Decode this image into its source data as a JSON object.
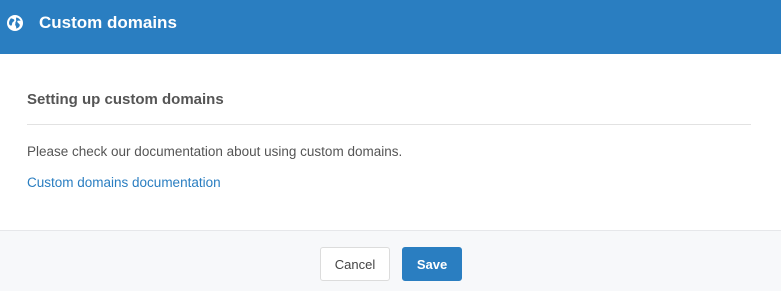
{
  "header": {
    "icon": "globe-icon",
    "title": "Custom domains"
  },
  "body": {
    "section_title": "Setting up custom domains",
    "description": "Please check our documentation about using custom domains.",
    "link_label": "Custom domains documentation"
  },
  "footer": {
    "cancel_label": "Cancel",
    "save_label": "Save"
  },
  "colors": {
    "accent": "#2a7ec1",
    "text": "#555555",
    "footer_bg": "#f7f8fa"
  }
}
